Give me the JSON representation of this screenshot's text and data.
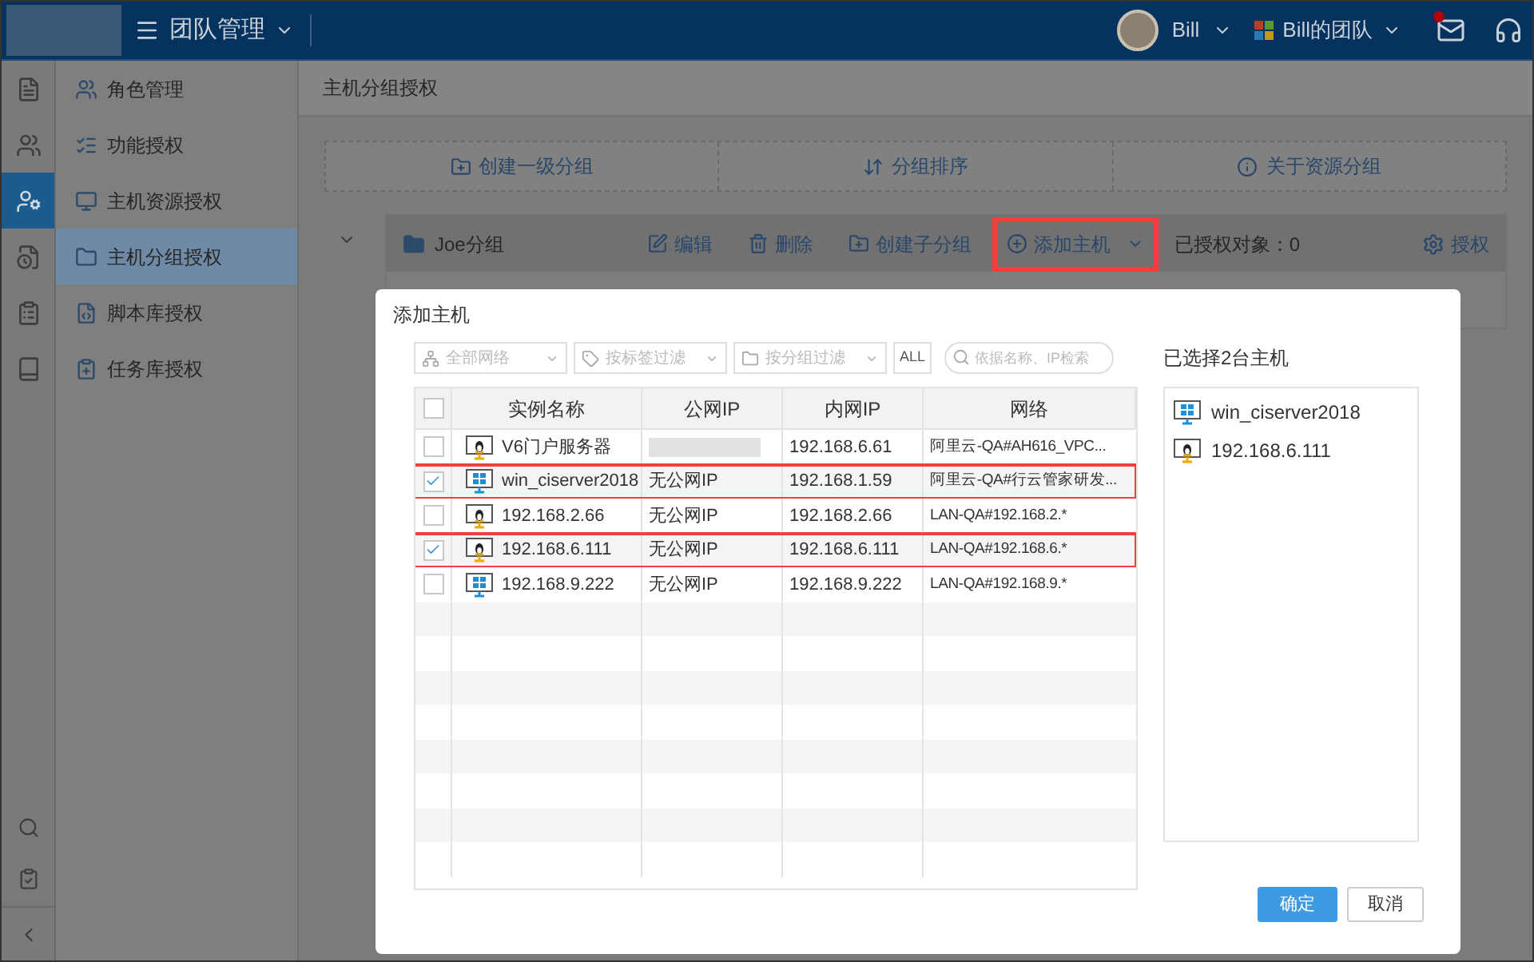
{
  "header": {
    "title": "团队管理",
    "user": "Bill",
    "team": "Bill的团队",
    "mail_unread": true
  },
  "rail": [
    {
      "selected": false
    },
    {
      "selected": false
    },
    {
      "selected": true
    },
    {
      "selected": false
    },
    {
      "selected": false
    },
    {
      "selected": false
    }
  ],
  "menu": [
    {
      "label": "角色管理",
      "selected": false
    },
    {
      "label": "功能授权",
      "selected": false
    },
    {
      "label": "主机资源授权",
      "selected": false
    },
    {
      "label": "主机分组授权",
      "selected": true
    },
    {
      "label": "脚本库授权",
      "selected": false
    },
    {
      "label": "任务库授权",
      "selected": false
    }
  ],
  "page_title": "主机分组授权",
  "actions": [
    "创建一级分组",
    "分组排序",
    "关于资源分组"
  ],
  "group": {
    "name": "Joe分组",
    "buttons": [
      {
        "label": "编辑",
        "highlighted": false
      },
      {
        "label": "删除",
        "highlighted": false
      },
      {
        "label": "创建子分组",
        "highlighted": false
      },
      {
        "label": "添加主机",
        "highlighted": true
      }
    ],
    "authorized": "已授权对象：0",
    "authorize_button": "授权"
  },
  "dialog": {
    "title": "添加主机",
    "filters": [
      {
        "kind": "select",
        "placeholder": "全部网络"
      },
      {
        "kind": "select",
        "placeholder": "按标签过滤"
      },
      {
        "kind": "select",
        "placeholder": "按分组过滤"
      },
      {
        "kind": "toggle",
        "label": "ALL"
      },
      {
        "kind": "search",
        "placeholder": "依据名称、IP检索"
      }
    ],
    "table": {
      "all_checked": false,
      "columns": [
        "实例名称",
        "公网IP",
        "内网IP",
        "网络"
      ],
      "rows": [
        {
          "checked": false,
          "highlighted": false,
          "kind": "linux",
          "name": "V6门户服务器",
          "public_ip": "",
          "redacted": true,
          "internal_ip": "192.168.6.61",
          "network": "阿里云-QA#AH616_VPC..."
        },
        {
          "checked": true,
          "highlighted": true,
          "kind": "windows",
          "name": "win_ciserver2018",
          "public_ip": "无公网IP",
          "redacted": false,
          "internal_ip": "192.168.1.59",
          "network": "阿里云-QA#行云管家研发..."
        },
        {
          "checked": false,
          "highlighted": false,
          "kind": "linux",
          "name": "192.168.2.66",
          "public_ip": "无公网IP",
          "redacted": false,
          "internal_ip": "192.168.2.66",
          "network": "LAN-QA#192.168.2.*"
        },
        {
          "checked": true,
          "highlighted": true,
          "kind": "linux",
          "name": "192.168.6.111",
          "public_ip": "无公网IP",
          "redacted": false,
          "internal_ip": "192.168.6.111",
          "network": "LAN-QA#192.168.6.*"
        },
        {
          "checked": false,
          "highlighted": false,
          "kind": "windows",
          "name": "192.168.9.222",
          "public_ip": "无公网IP",
          "redacted": false,
          "internal_ip": "192.168.9.222",
          "network": "LAN-QA#192.168.9.*"
        }
      ]
    },
    "selected_title": "已选择2台主机",
    "selected": [
      {
        "kind": "windows",
        "name": "win_ciserver2018"
      },
      {
        "kind": "linux",
        "name": "192.168.6.111"
      }
    ],
    "ok": "确定",
    "cancel": "取消"
  }
}
